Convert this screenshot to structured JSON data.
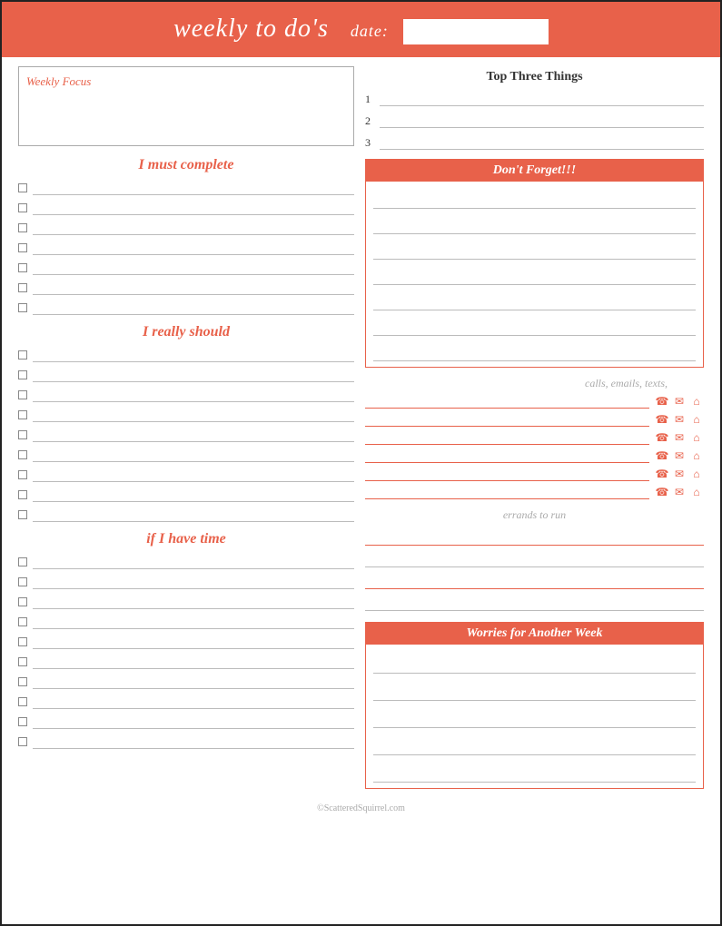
{
  "header": {
    "title": "weekly to do's",
    "date_label": "date:",
    "date_value": ""
  },
  "weekly_focus": {
    "label": "Weekly Focus"
  },
  "sections": {
    "must_complete": "I must complete",
    "really_should": "I really should",
    "if_have_time": "if I have time"
  },
  "top_three": {
    "header": "Top Three Things",
    "numbers": [
      "1",
      "2",
      "3"
    ]
  },
  "dont_forget": {
    "header": "Don't Forget!!!",
    "lines": 7
  },
  "contacts": {
    "header": "calls, emails, texts,",
    "rows": 6,
    "icons": [
      "☎",
      "✉",
      "⌂"
    ]
  },
  "errands": {
    "header": "errands to run",
    "lines": 4
  },
  "worries": {
    "header": "Worries for Another Week",
    "lines": 5
  },
  "footer": {
    "text": "©ScatteredSquirrel.com"
  },
  "checkbox_rows": {
    "must_complete": 7,
    "really_should": 9,
    "if_have_time": 10
  }
}
